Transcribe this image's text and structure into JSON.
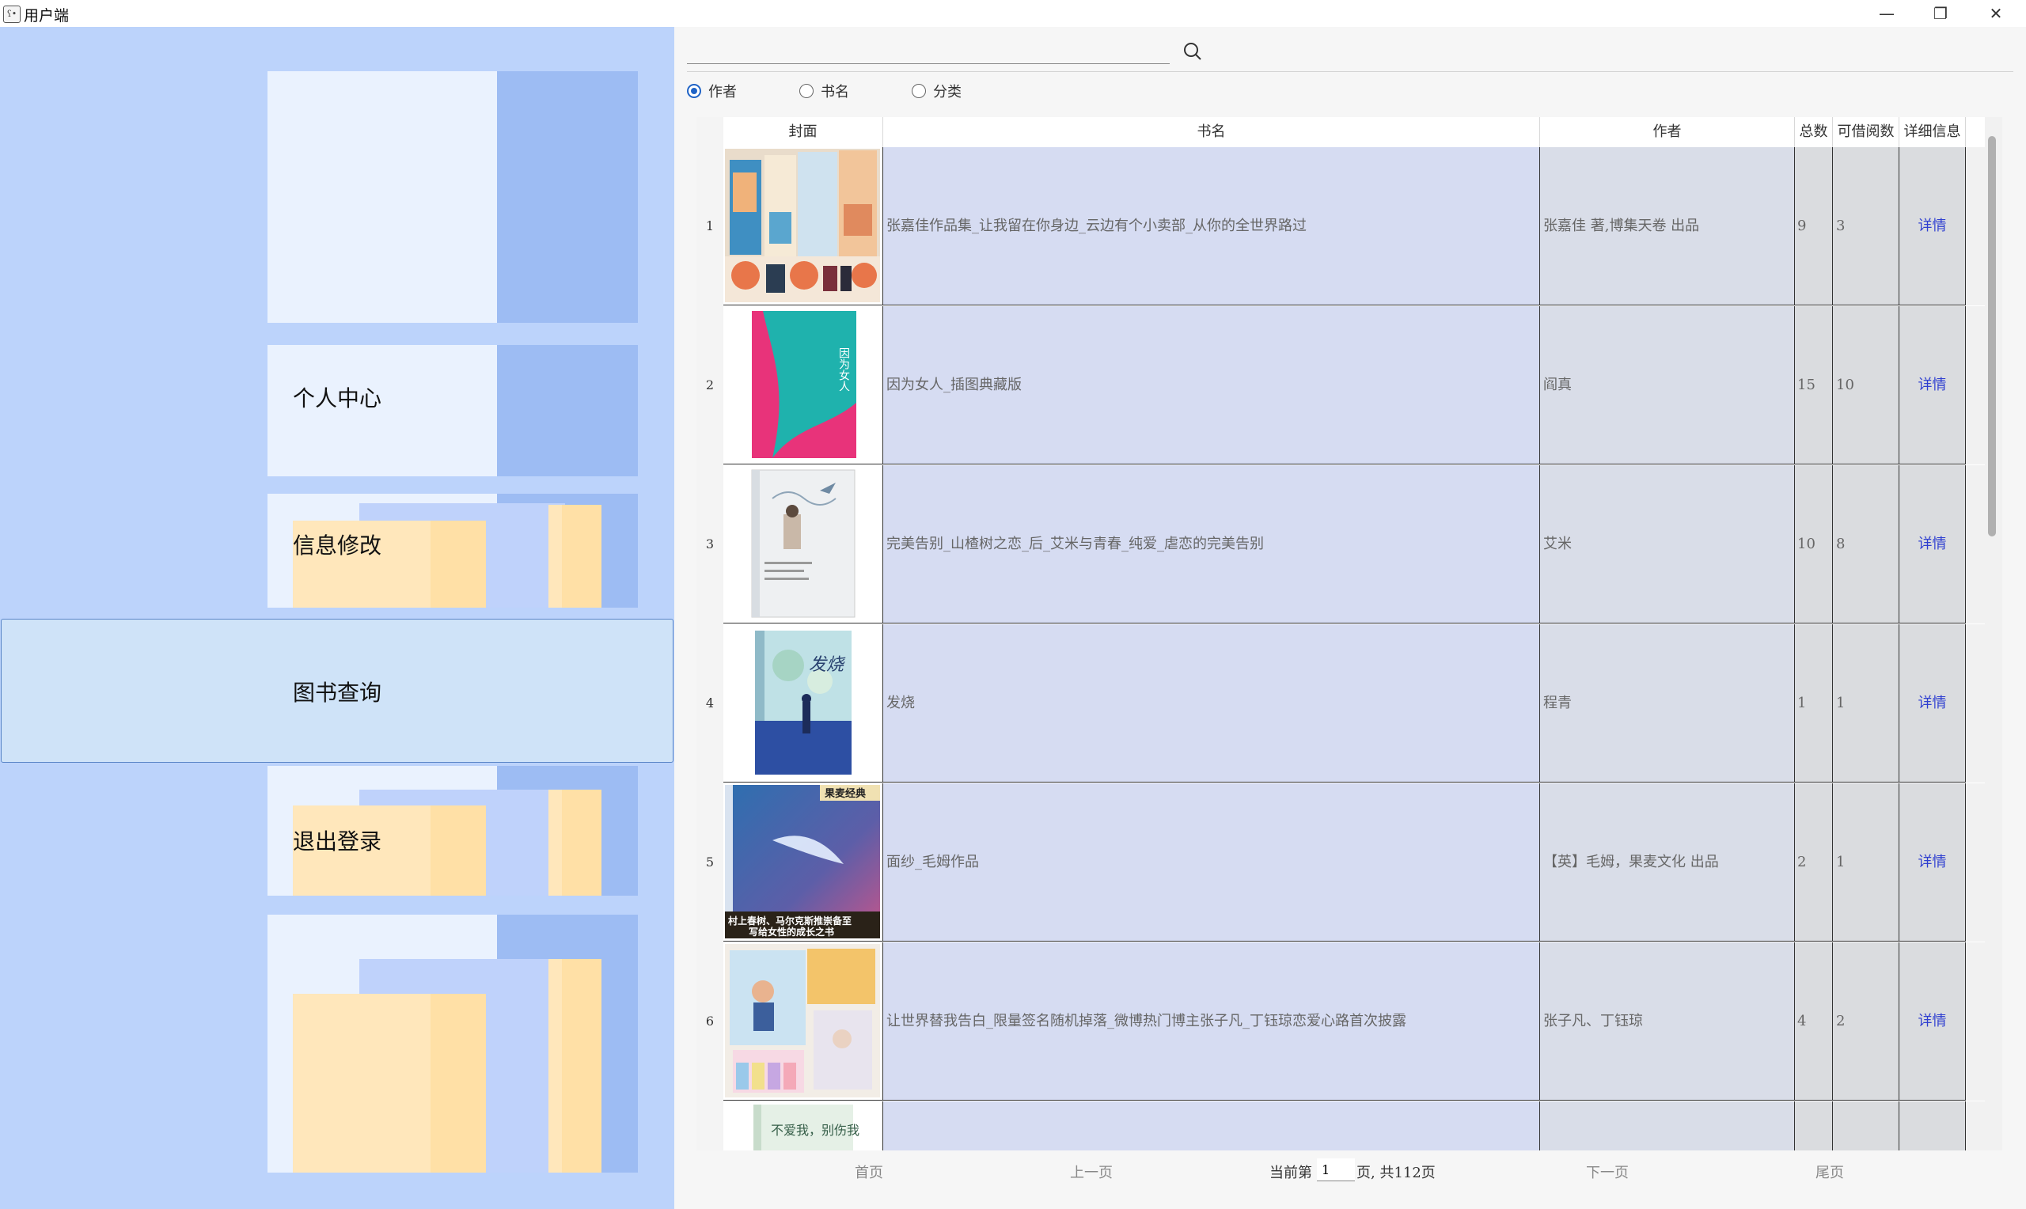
{
  "window": {
    "title": "用户端",
    "icon_label": "ʕ•",
    "controls": {
      "minimize": "—",
      "maximize": "❐",
      "close": "✕"
    }
  },
  "sidebar": {
    "items": [
      {
        "label": "个人中心"
      },
      {
        "label": "信息修改"
      },
      {
        "label": "图书查询",
        "active": true
      },
      {
        "label": "退出登录"
      }
    ]
  },
  "search": {
    "value": "",
    "placeholder": "",
    "options": [
      {
        "label": "作者",
        "checked": true
      },
      {
        "label": "书名",
        "checked": false
      },
      {
        "label": "分类",
        "checked": false
      }
    ]
  },
  "table": {
    "columns": [
      "封面",
      "书名",
      "作者",
      "总数",
      "可借阅数",
      "详细信息"
    ],
    "rows": [
      {
        "no": "1",
        "title": "张嘉佳作品集_让我留在你身边_云边有个小卖部_从你的全世界路过",
        "author": "张嘉佳 著,博集天卷 出品",
        "total": "9",
        "available": "3",
        "detail": "详情"
      },
      {
        "no": "2",
        "title": "因为女人_插图典藏版",
        "author": "阎真",
        "total": "15",
        "available": "10",
        "detail": "详情"
      },
      {
        "no": "3",
        "title": "完美告别_山楂树之恋_后_艾米与青春_纯爱_虐恋的完美告别",
        "author": "艾米",
        "total": "10",
        "available": "8",
        "detail": "详情"
      },
      {
        "no": "4",
        "title": "发烧",
        "author": "程青",
        "total": "1",
        "available": "1",
        "detail": "详情"
      },
      {
        "no": "5",
        "title": "面纱_毛姆作品",
        "author": "【英】毛姆，果麦文化 出品",
        "total": "2",
        "available": "1",
        "detail": "详情"
      },
      {
        "no": "6",
        "title": "让世界替我告白_限量签名随机掉落_微博热门博主张子凡_丁钰琼恋爱心路首次披露",
        "author": "张子凡、丁钰琼",
        "total": "4",
        "available": "2",
        "detail": "详情"
      },
      {
        "no": "7",
        "title": "",
        "author": "",
        "total": "",
        "available": "",
        "detail": ""
      }
    ],
    "cover_texts": {
      "book2": "因为女人",
      "book4": "发烧",
      "book5_badge": "果麦经典",
      "book5_banner1": "村上春树、马尔克斯推崇备至",
      "book5_banner2": "写给女性的成长之书",
      "book7": "不爱我，别伤我"
    }
  },
  "pager": {
    "first": "首页",
    "prev": "上一页",
    "current_prefix": "当前第",
    "current_page": "1",
    "total_text": "页, 共112页",
    "next": "下一页",
    "last": "尾页"
  }
}
